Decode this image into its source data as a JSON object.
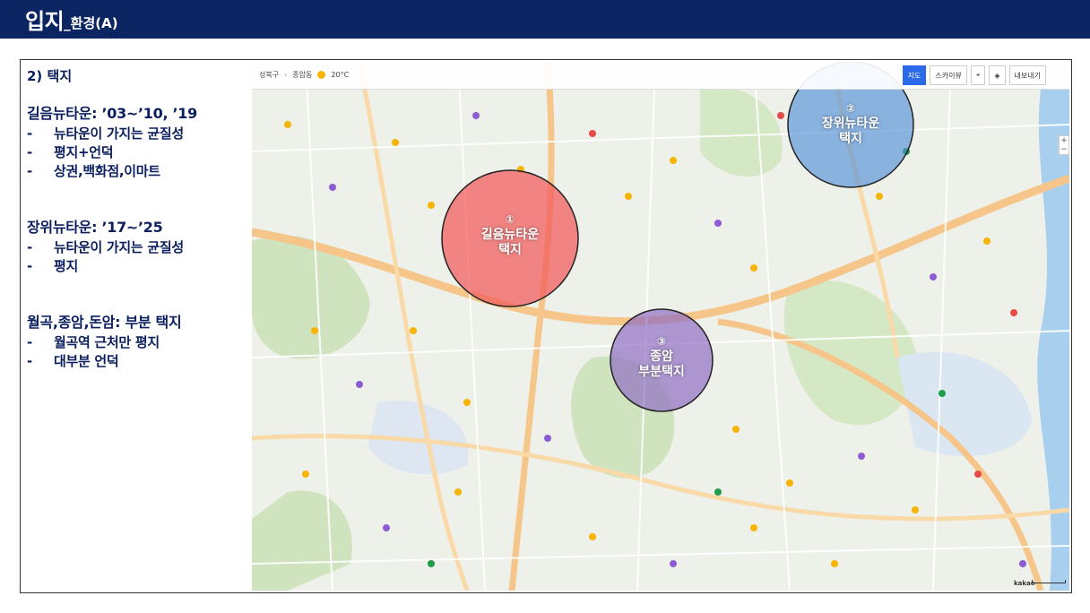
{
  "header": {
    "title_main": "입지",
    "title_sub": "_환경(A)"
  },
  "text_panel": {
    "section_title": "2) 택지",
    "blocks": [
      {
        "head": "길음뉴타운: ’03~’10, ’19",
        "bullets": [
          "뉴타운이 가지는 균질성",
          "평지+언덕",
          "상권,백화점,이마트"
        ]
      },
      {
        "head": "장위뉴타운: ’17~’25",
        "bullets": [
          "뉴타운이 가지는 균질성",
          "평지"
        ]
      },
      {
        "head": "월곡,종암,돈암: 부분 택지",
        "bullets": [
          "월곡역 근처만 평지",
          "대부분 언덕"
        ]
      }
    ]
  },
  "map": {
    "breadcrumb": [
      "성북구",
      "종암동"
    ],
    "weather": "20°C",
    "buttons": {
      "map": "지도",
      "skyview": "스카이뷰",
      "export": "내보내기"
    },
    "zoom_plus": "+",
    "zoom_minus": "−",
    "provider": "kakao",
    "circles": [
      {
        "num": "①",
        "line1": "길음뉴타운",
        "line2": "택지",
        "color": "#f25a5a"
      },
      {
        "num": "②",
        "line1": "장위뉴타운",
        "line2": "택지",
        "color": "#4a8cd9"
      },
      {
        "num": "③",
        "line1": "종암",
        "line2": "부분택지",
        "color": "#8e6cc4"
      }
    ]
  }
}
